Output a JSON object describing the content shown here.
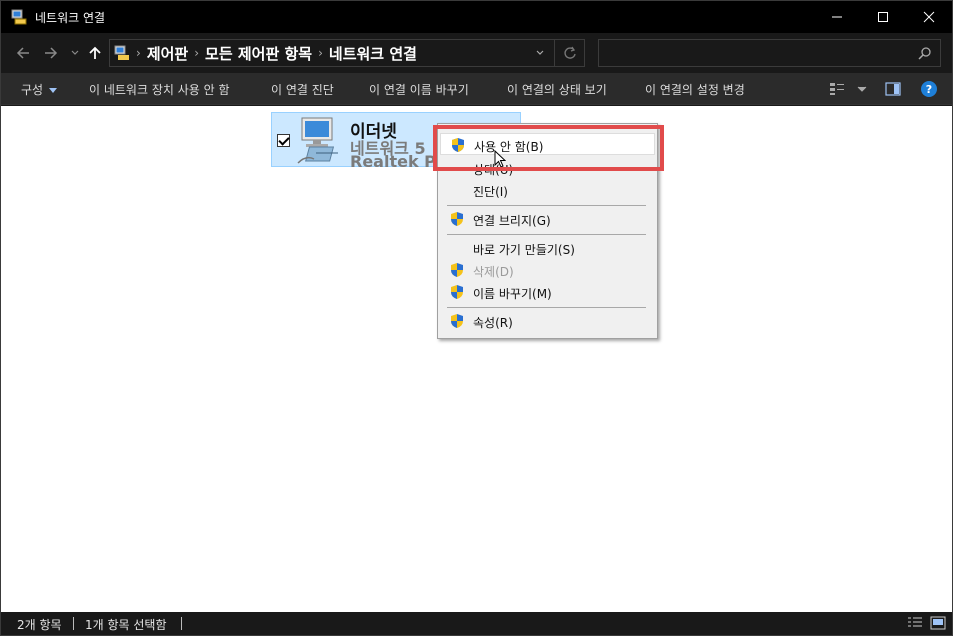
{
  "window": {
    "title": "네트워크 연결",
    "minimize_glyph": "─",
    "maximize_glyph": "☐",
    "close_glyph": "✕"
  },
  "nav": {
    "back": "←",
    "forward": "→",
    "recent": "⌄",
    "up": "↑"
  },
  "breadcrumb": [
    "제어판",
    "모든 제어판 항목",
    "네트워크 연결"
  ],
  "search": {
    "placeholder": ""
  },
  "commands": {
    "organize": "구성",
    "disable_device": "이 네트워크 장치 사용 안 함",
    "diagnose": "이 연결 진단",
    "rename": "이 연결 이름 바꾸기",
    "view_status": "이 연결의 상태 보기",
    "change_settings": "이 연결의 설정 변경"
  },
  "connection": {
    "name": "이더넷",
    "network": "네트워크 5",
    "adapter": "Realtek PCIe"
  },
  "context_menu": {
    "items": [
      {
        "label": "사용 안 함(B)",
        "icon": "shield-icon"
      },
      {
        "label": "상태(U)",
        "icon": ""
      },
      {
        "label": "진단(I)",
        "icon": ""
      },
      {
        "label": "연결 브리지(G)",
        "icon": "shield-icon"
      },
      {
        "label": "바로 가기 만들기(S)",
        "icon": ""
      },
      {
        "label": "삭제(D)",
        "icon": "shield-icon",
        "disabled": true
      },
      {
        "label": "이름 바꾸기(M)",
        "icon": "shield-icon"
      },
      {
        "label": "속성(R)",
        "icon": "shield-icon"
      }
    ]
  },
  "status": {
    "item_count": "2개 항목",
    "selected": "1개 항목 선택함"
  },
  "colors": {
    "highlight_box": "#e14b4b",
    "selection_bg": "#cce8ff",
    "help_blue": "#1e7fd8"
  }
}
